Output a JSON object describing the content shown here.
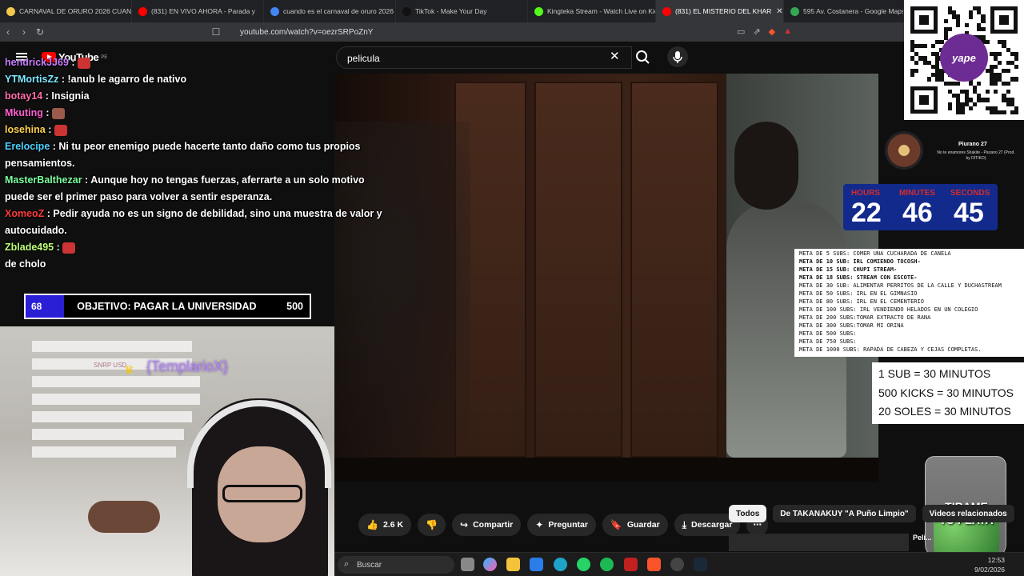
{
  "browser": {
    "tabs": [
      {
        "title": "CARNAVAL DE ORURO 2026 CUANDO",
        "color": "#f2c94c",
        "active": false
      },
      {
        "title": "(831) EN VIVO AHORA - Parada y",
        "color": "#ff0000",
        "active": false
      },
      {
        "title": "cuando es el carnaval de oruro 2026",
        "color": "#4285f4",
        "active": false
      },
      {
        "title": "TikTok - Make Your Day",
        "color": "#111111",
        "active": false
      },
      {
        "title": "Kingteka Stream - Watch Live on Kick",
        "color": "#53fc18",
        "active": false
      },
      {
        "title": "(831) EL MISTERIO DEL KHAR",
        "color": "#ff0000",
        "active": true
      },
      {
        "title": "595 Av. Costanera - Google Maps",
        "color": "#34a853",
        "active": false
      }
    ],
    "url": "youtube.com/watch?v=oezrSRPoZnY"
  },
  "youtube": {
    "logo_text": "YouTube",
    "country": "PE",
    "search_value": "pelicula",
    "actions": [
      {
        "icon": "like-icon",
        "label": "2.6 K"
      },
      {
        "icon": "dislike-icon",
        "label": ""
      },
      {
        "icon": "share-icon",
        "label": "Compartir"
      },
      {
        "icon": "ask-icon",
        "label": "Preguntar"
      },
      {
        "icon": "save-icon",
        "label": "Guardar"
      },
      {
        "icon": "download-icon",
        "label": "Descargar"
      },
      {
        "icon": "more-icon",
        "label": "⋯"
      }
    ],
    "chips": [
      "Todos",
      "De TAKANAKUY \"A Puño Limpio\"",
      "Videos relacionados"
    ],
    "side_title": "Peli..."
  },
  "chat": [
    {
      "user": "hendrickJJ69",
      "color": "#c77dff",
      "text": ""
    },
    {
      "user": "YTMortisZz",
      "color": "#7ee7ff",
      "text": "!anub le agarro de nativo"
    },
    {
      "user": "botay14",
      "color": "#ff6fa8",
      "text": "Insignia"
    },
    {
      "user": "Mkuting",
      "color": "#ff5fd1",
      "text": ""
    },
    {
      "user": "losehina",
      "color": "#ffd34d",
      "text": ""
    },
    {
      "user": "Erelocipe",
      "color": "#4dd2ff",
      "text": "Ni tu peor enemigo puede hacerte tanto daño como tus propios pensamientos."
    },
    {
      "user": "MasterBalthezar",
      "color": "#7dff9e",
      "text": "Aunque hoy no tengas fuerzas, aferrarte a un solo motivo puede ser el primer paso para volver a sentir esperanza."
    },
    {
      "user": "XomeoZ",
      "color": "#ff3b3b",
      "text": "Pedir ayuda no es un signo de debilidad, sino una muestra de valor y autocuidado."
    },
    {
      "user": "Zblade495",
      "color": "#bfff7a",
      "text": ""
    },
    {
      "user": "",
      "color": "#ffffff",
      "text": "de cholo"
    }
  ],
  "goal": {
    "current": "68",
    "title": "OBJETIVO: PAGAR LA UNIVERSIDAD",
    "target": "500",
    "progress": 0.136
  },
  "webcam": {
    "tts_label": "SNRP USD",
    "tts_name": "{TemplarioX}"
  },
  "qr": {
    "brand": "yape"
  },
  "music": {
    "title": "Piurano 27",
    "subtitle": "No te enamores Shakite - Piurano 27 (Prod. by DITIKO)"
  },
  "timer": {
    "labels": [
      "HOURS",
      "MINUTES",
      "SECONDS"
    ],
    "values": [
      "22",
      "46",
      "45"
    ]
  },
  "sub_goals": [
    {
      "text": "META DE 5 SUBS: COMER UNA CUCHARADA DE CANELA",
      "bold": false
    },
    {
      "text": "META DE 10 SUB: IRL COMIENDO TOCOSH-",
      "bold": true
    },
    {
      "text": "META DE 15 SUB: CHUPI STREAM-",
      "bold": true
    },
    {
      "text": "META DE 18 SUBS: STREAM CON ESCOTE-",
      "bold": true
    },
    {
      "text": "META DE 30 SUB:  ALIMENTAR PERRITOS DE LA CALLE Y DUCHASTREAM",
      "bold": false
    },
    {
      "text": "META DE 50 SUBS: IRL EN EL GIMNASIO",
      "bold": false
    },
    {
      "text": "META DE 80 SUBS: IRL EN EL CEMENTERIO",
      "bold": false
    },
    {
      "text": "META DE 100 SUBS: IRL VENDIENDO HELADOS EN UN COLEGIO",
      "bold": false
    },
    {
      "text": "META DE 200 SUBS:TOMAR EXTRACTO DE RANA",
      "bold": false
    },
    {
      "text": "META DE 300 SUBS:TOMAR MI ORINA",
      "bold": false
    },
    {
      "text": "META DE 500 SUBS:",
      "bold": false
    },
    {
      "text": "META DE 750 SUBS:",
      "bold": false
    },
    {
      "text": "META DE 1000 SUBS: RAPADA DE CABEZA Y CEJAS COMPLETAS.",
      "bold": false
    }
  ],
  "rates": [
    "1 SUB = 30 MINUTOS",
    "500 KICKS = 30 MINUTOS",
    "20 SOLES = 30 MINUTOS"
  ],
  "jar": {
    "line1": "TIRAME",
    "line2": "TU PLATA"
  },
  "taskbar": {
    "search_placeholder": "Buscar",
    "time": "12:53",
    "date": "9/02/2026"
  }
}
